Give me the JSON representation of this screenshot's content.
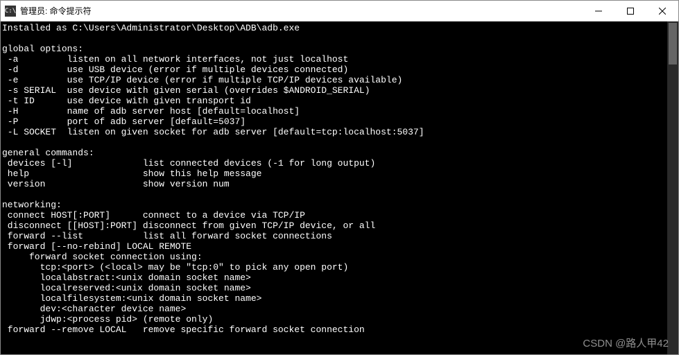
{
  "titlebar": {
    "icon_text": "C:\\",
    "title": "管理员: 命令提示符"
  },
  "window_controls": {
    "minimize": "Minimize",
    "maximize": "Maximize",
    "close": "Close"
  },
  "terminal": {
    "lines": [
      "Installed as C:\\Users\\Administrator\\Desktop\\ADB\\adb.exe",
      "",
      "global options:",
      " -a         listen on all network interfaces, not just localhost",
      " -d         use USB device (error if multiple devices connected)",
      " -e         use TCP/IP device (error if multiple TCP/IP devices available)",
      " -s SERIAL  use device with given serial (overrides $ANDROID_SERIAL)",
      " -t ID      use device with given transport id",
      " -H         name of adb server host [default=localhost]",
      " -P         port of adb server [default=5037]",
      " -L SOCKET  listen on given socket for adb server [default=tcp:localhost:5037]",
      "",
      "general commands:",
      " devices [-l]             list connected devices (-1 for long output)",
      " help                     show this help message",
      " version                  show version num",
      "",
      "networking:",
      " connect HOST[:PORT]      connect to a device via TCP/IP",
      " disconnect [[HOST]:PORT] disconnect from given TCP/IP device, or all",
      " forward --list           list all forward socket connections",
      " forward [--no-rebind] LOCAL REMOTE",
      "     forward socket connection using:",
      "       tcp:<port> (<local> may be \"tcp:0\" to pick any open port)",
      "       localabstract:<unix domain socket name>",
      "       localreserved:<unix domain socket name>",
      "       localfilesystem:<unix domain socket name>",
      "       dev:<character device name>",
      "       jdwp:<process pid> (remote only)",
      " forward --remove LOCAL   remove specific forward socket connection"
    ]
  },
  "watermark": "CSDN @路人甲42"
}
